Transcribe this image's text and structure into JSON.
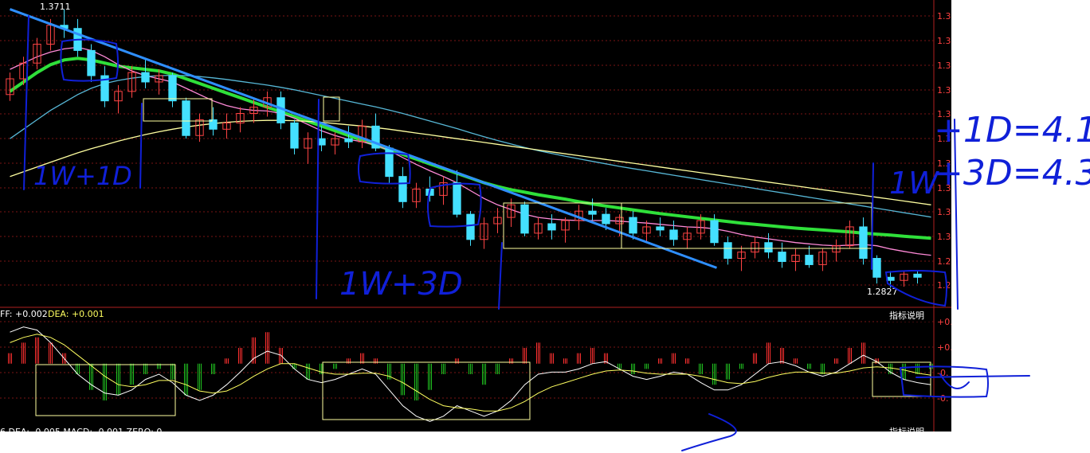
{
  "price_panel": {
    "high_label": "1.3711",
    "low_label": "1.2827",
    "right_axis_labels": [
      "1.3",
      "1.3",
      "1.3",
      "1.3",
      "1.3",
      "1.3",
      "1.3",
      "1.3",
      "1.3",
      "1.3",
      "1.2",
      "1.2"
    ]
  },
  "macd_panel": {
    "dif_text": "FF: +0.002",
    "dea_text": "DEA: +0.001",
    "explain_button": "指标说明",
    "right_axis_labels": [
      "+0.",
      "+0.",
      "-0.",
      "-0."
    ],
    "bottom_cut_text": "6 DEA: -0.005  MACD: -0.001  ZERO: 0",
    "bottom_explain_button": "指标说明"
  },
  "annotations": {
    "label_1w1d": "1W+1D",
    "label_1w3d": "1W+3D",
    "label_1w_right": "1W",
    "eq1": "+1D=4.1",
    "eq2": "+3D=4.3"
  },
  "colors": {
    "background": "#000000",
    "grid": "#7a1414",
    "up_candle": "#ff4444",
    "down_candle": "#44e0ff",
    "ma_green": "#2fe03a",
    "ma_pink": "#ff8ad8",
    "ma_cyan": "#57b7d6",
    "ma_yellow": "#ffffa0",
    "trend_blue": "#2f8fff",
    "hand_ink": "#1020d8",
    "macd_up": "#ff3030",
    "macd_down": "#20c020"
  },
  "chart_data": {
    "type": "candlestick",
    "price_range": [
      1.28,
      1.372
    ],
    "candles": [
      [
        1.344,
        1.351,
        1.342,
        1.349
      ],
      [
        1.349,
        1.356,
        1.347,
        1.354
      ],
      [
        1.354,
        1.362,
        1.352,
        1.36
      ],
      [
        1.36,
        1.368,
        1.358,
        1.366
      ],
      [
        1.366,
        1.3711,
        1.362,
        1.365
      ],
      [
        1.365,
        1.368,
        1.356,
        1.358
      ],
      [
        1.358,
        1.36,
        1.348,
        1.35
      ],
      [
        1.35,
        1.353,
        1.34,
        1.342
      ],
      [
        1.342,
        1.347,
        1.338,
        1.345
      ],
      [
        1.345,
        1.353,
        1.343,
        1.351
      ],
      [
        1.351,
        1.355,
        1.346,
        1.348
      ],
      [
        1.348,
        1.352,
        1.344,
        1.35
      ],
      [
        1.35,
        1.351,
        1.34,
        1.342
      ],
      [
        1.342,
        1.343,
        1.33,
        1.331
      ],
      [
        1.331,
        1.338,
        1.329,
        1.336
      ],
      [
        1.336,
        1.34,
        1.331,
        1.333
      ],
      [
        1.333,
        1.338,
        1.33,
        1.335
      ],
      [
        1.335,
        1.34,
        1.332,
        1.338
      ],
      [
        1.338,
        1.343,
        1.335,
        1.34
      ],
      [
        1.34,
        1.345,
        1.337,
        1.343
      ],
      [
        1.343,
        1.345,
        1.333,
        1.335
      ],
      [
        1.335,
        1.336,
        1.325,
        1.327
      ],
      [
        1.327,
        1.332,
        1.322,
        1.33
      ],
      [
        1.33,
        1.334,
        1.326,
        1.328
      ],
      [
        1.328,
        1.332,
        1.325,
        1.33
      ],
      [
        1.33,
        1.334,
        1.327,
        1.329
      ],
      [
        1.329,
        1.336,
        1.327,
        1.334
      ],
      [
        1.334,
        1.338,
        1.326,
        1.327
      ],
      [
        1.327,
        1.328,
        1.316,
        1.318
      ],
      [
        1.318,
        1.321,
        1.308,
        1.31
      ],
      [
        1.31,
        1.316,
        1.308,
        1.314
      ],
      [
        1.314,
        1.318,
        1.31,
        1.312
      ],
      [
        1.312,
        1.318,
        1.309,
        1.316
      ],
      [
        1.316,
        1.32,
        1.305,
        1.306
      ],
      [
        1.306,
        1.307,
        1.296,
        1.298
      ],
      [
        1.298,
        1.305,
        1.295,
        1.303
      ],
      [
        1.303,
        1.308,
        1.3,
        1.305
      ],
      [
        1.305,
        1.311,
        1.302,
        1.309
      ],
      [
        1.309,
        1.31,
        1.299,
        1.3
      ],
      [
        1.3,
        1.305,
        1.298,
        1.303
      ],
      [
        1.303,
        1.306,
        1.298,
        1.301
      ],
      [
        1.301,
        1.305,
        1.297,
        1.304
      ],
      [
        1.304,
        1.309,
        1.301,
        1.307
      ],
      [
        1.307,
        1.311,
        1.304,
        1.306
      ],
      [
        1.306,
        1.308,
        1.301,
        1.303
      ],
      [
        1.303,
        1.306,
        1.299,
        1.305
      ],
      [
        1.305,
        1.307,
        1.298,
        1.3
      ],
      [
        1.3,
        1.304,
        1.297,
        1.302
      ],
      [
        1.302,
        1.305,
        1.299,
        1.301
      ],
      [
        1.301,
        1.304,
        1.296,
        1.298
      ],
      [
        1.298,
        1.302,
        1.295,
        1.3
      ],
      [
        1.3,
        1.306,
        1.298,
        1.304
      ],
      [
        1.304,
        1.306,
        1.296,
        1.297
      ],
      [
        1.297,
        1.299,
        1.29,
        1.292
      ],
      [
        1.292,
        1.296,
        1.288,
        1.294
      ],
      [
        1.294,
        1.299,
        1.292,
        1.297
      ],
      [
        1.297,
        1.3,
        1.292,
        1.294
      ],
      [
        1.294,
        1.297,
        1.289,
        1.291
      ],
      [
        1.291,
        1.295,
        1.288,
        1.293
      ],
      [
        1.293,
        1.296,
        1.289,
        1.29
      ],
      [
        1.29,
        1.295,
        1.288,
        1.294
      ],
      [
        1.294,
        1.298,
        1.291,
        1.296
      ],
      [
        1.296,
        1.304,
        1.295,
        1.302
      ],
      [
        1.302,
        1.305,
        1.29,
        1.292
      ],
      [
        1.292,
        1.293,
        1.284,
        1.286
      ],
      [
        1.286,
        1.288,
        1.2827,
        1.285
      ],
      [
        1.285,
        1.288,
        1.283,
        1.287
      ],
      [
        1.287,
        1.288,
        1.284,
        1.286
      ]
    ],
    "trendline": {
      "from": [
        0,
        1.3711
      ],
      "to": [
        51,
        1.289
      ]
    },
    "ma_series": [
      {
        "color": "#2fe03a",
        "values": [
          1.345,
          1.348,
          1.351,
          1.3535,
          1.355,
          1.3555,
          1.355,
          1.354,
          1.353,
          1.3525,
          1.352,
          1.3515,
          1.3505,
          1.349,
          1.3475,
          1.346,
          1.3445,
          1.343,
          1.3415,
          1.34,
          1.3385,
          1.337,
          1.3355,
          1.334,
          1.3325,
          1.331,
          1.3295,
          1.328,
          1.3265,
          1.325,
          1.3235,
          1.322,
          1.3205,
          1.319,
          1.3175,
          1.316,
          1.3148,
          1.3138,
          1.313,
          1.3122,
          1.3115,
          1.3108,
          1.31,
          1.3093,
          1.3086,
          1.308,
          1.3074,
          1.3068,
          1.3062,
          1.3057,
          1.3052,
          1.3047,
          1.3042,
          1.3037,
          1.3032,
          1.3028,
          1.3024,
          1.302,
          1.3016,
          1.3013,
          1.301,
          1.3007,
          1.3004,
          1.3,
          1.2997,
          1.2994,
          1.299,
          1.2987,
          1.2984
        ]
      },
      {
        "color": "#ff8ad8",
        "values": [
          1.352,
          1.354,
          1.356,
          1.3575,
          1.3585,
          1.359,
          1.358,
          1.356,
          1.3535,
          1.3515,
          1.35,
          1.349,
          1.348,
          1.346,
          1.344,
          1.342,
          1.3405,
          1.3395,
          1.339,
          1.3388,
          1.338,
          1.3365,
          1.3345,
          1.3325,
          1.331,
          1.3298,
          1.329,
          1.328,
          1.3262,
          1.324,
          1.3218,
          1.3198,
          1.318,
          1.316,
          1.3135,
          1.311,
          1.309,
          1.3075,
          1.306,
          1.305,
          1.3045,
          1.3042,
          1.304,
          1.304,
          1.304,
          1.3038,
          1.3035,
          1.3032,
          1.3028,
          1.3024,
          1.302,
          1.3018,
          1.3014,
          1.3006,
          1.2996,
          1.2988,
          1.2982,
          1.2976,
          1.297,
          1.2966,
          1.2962,
          1.296,
          1.2962,
          1.2964,
          1.296,
          1.295,
          1.2942,
          1.2935,
          1.293
        ]
      },
      {
        "color": "#57b7d6",
        "values": [
          1.33,
          1.333,
          1.336,
          1.339,
          1.3415,
          1.344,
          1.346,
          1.3475,
          1.3485,
          1.3492,
          1.3497,
          1.35,
          1.3501,
          1.35,
          1.3497,
          1.3493,
          1.3488,
          1.3482,
          1.3476,
          1.347,
          1.3463,
          1.3455,
          1.3446,
          1.3437,
          1.3428,
          1.3419,
          1.341,
          1.3401,
          1.3391,
          1.338,
          1.3368,
          1.3356,
          1.3344,
          1.3332,
          1.3319,
          1.3306,
          1.3294,
          1.3283,
          1.3272,
          1.3262,
          1.3253,
          1.3244,
          1.3236,
          1.3228,
          1.322,
          1.3212,
          1.3205,
          1.3198,
          1.3191,
          1.3184,
          1.3177,
          1.317,
          1.3163,
          1.3156,
          1.3149,
          1.3142,
          1.3135,
          1.3128,
          1.3121,
          1.3114,
          1.3107,
          1.31,
          1.3093,
          1.3086,
          1.3079,
          1.3072,
          1.3065,
          1.3058,
          1.3051
        ]
      },
      {
        "color": "#ffffa0",
        "values": [
          1.318,
          1.3195,
          1.321,
          1.3225,
          1.324,
          1.3255,
          1.3268,
          1.328,
          1.3292,
          1.3303,
          1.3313,
          1.3322,
          1.333,
          1.3337,
          1.3343,
          1.3348,
          1.3352,
          1.3355,
          1.3357,
          1.3358,
          1.3358,
          1.3357,
          1.3355,
          1.3352,
          1.3348,
          1.3344,
          1.334,
          1.3335,
          1.333,
          1.3324,
          1.3318,
          1.3312,
          1.3306,
          1.33,
          1.3294,
          1.3288,
          1.3282,
          1.3276,
          1.327,
          1.3264,
          1.3258,
          1.3252,
          1.3246,
          1.324,
          1.3234,
          1.3228,
          1.3222,
          1.3216,
          1.321,
          1.3204,
          1.3198,
          1.3192,
          1.3186,
          1.318,
          1.3174,
          1.3168,
          1.3162,
          1.3156,
          1.315,
          1.3144,
          1.3138,
          1.3132,
          1.3126,
          1.312,
          1.3114,
          1.3108,
          1.3102,
          1.3096,
          1.309
        ]
      }
    ],
    "macd": {
      "range": [
        -0.006,
        0.004
      ],
      "hist": [
        0.001,
        0.002,
        0.0025,
        0.002,
        0.001,
        -0.001,
        -0.0025,
        -0.0035,
        -0.003,
        -0.002,
        -0.001,
        -0.0005,
        -0.0015,
        -0.003,
        -0.0025,
        -0.001,
        0.0005,
        0.0015,
        0.0025,
        0.003,
        0.0015,
        -0.0005,
        -0.0015,
        -0.001,
        -0.0005,
        0.0005,
        0.001,
        0.0005,
        -0.0015,
        -0.003,
        -0.0035,
        -0.0025,
        -0.001,
        0.0005,
        -0.001,
        -0.002,
        -0.001,
        0.0005,
        0.0015,
        0.002,
        0.001,
        0.0005,
        0.001,
        0.0015,
        0.001,
        -0.0005,
        -0.001,
        -0.0005,
        0.0005,
        0.001,
        0.0005,
        -0.001,
        -0.002,
        -0.0015,
        -0.0005,
        0.001,
        0.002,
        0.0015,
        0.0005,
        -0.0005,
        -0.001,
        0.0005,
        0.0015,
        0.002,
        0.0005,
        -0.001,
        -0.0015,
        -0.001,
        -0.0005
      ],
      "dif": [
        0.003,
        0.0035,
        0.0032,
        0.002,
        0.0005,
        -0.001,
        -0.002,
        -0.0028,
        -0.003,
        -0.0025,
        -0.0015,
        -0.001,
        -0.0018,
        -0.003,
        -0.0035,
        -0.003,
        -0.002,
        -0.0008,
        0.0005,
        0.0012,
        0.0008,
        -0.0005,
        -0.0015,
        -0.0018,
        -0.0015,
        -0.001,
        -0.0005,
        -0.001,
        -0.0025,
        -0.004,
        -0.005,
        -0.0055,
        -0.005,
        -0.004,
        -0.0045,
        -0.005,
        -0.0045,
        -0.0035,
        -0.002,
        -0.001,
        -0.0008,
        -0.0008,
        -0.0005,
        0.0,
        0.0002,
        -0.0005,
        -0.0012,
        -0.0015,
        -0.0012,
        -0.0008,
        -0.001,
        -0.0018,
        -0.0025,
        -0.0025,
        -0.002,
        -0.001,
        0.0,
        0.0002,
        -0.0002,
        -0.0008,
        -0.0012,
        -0.0008,
        0.0,
        0.0008,
        0.0002,
        -0.0008,
        -0.0015,
        -0.0018,
        -0.002
      ],
      "dea": [
        0.002,
        0.0025,
        0.0028,
        0.0025,
        0.0018,
        0.0008,
        -0.0002,
        -0.0012,
        -0.002,
        -0.0022,
        -0.002,
        -0.0016,
        -0.0016,
        -0.002,
        -0.0026,
        -0.0028,
        -0.0026,
        -0.002,
        -0.0012,
        -0.0005,
        0.0,
        0.0,
        -0.0004,
        -0.0008,
        -0.001,
        -0.001,
        -0.0009,
        -0.0009,
        -0.0012,
        -0.0018,
        -0.0026,
        -0.0034,
        -0.004,
        -0.0042,
        -0.0043,
        -0.0045,
        -0.0045,
        -0.0042,
        -0.0036,
        -0.0028,
        -0.0022,
        -0.0018,
        -0.0014,
        -0.001,
        -0.0007,
        -0.0006,
        -0.0007,
        -0.0009,
        -0.001,
        -0.001,
        -0.001,
        -0.0012,
        -0.0015,
        -0.0018,
        -0.0019,
        -0.0017,
        -0.0013,
        -0.001,
        -0.0008,
        -0.0008,
        -0.0009,
        -0.0009,
        -0.0007,
        -0.0004,
        -0.0003,
        -0.0004,
        -0.0006,
        -0.0009,
        -0.0011
      ]
    }
  }
}
